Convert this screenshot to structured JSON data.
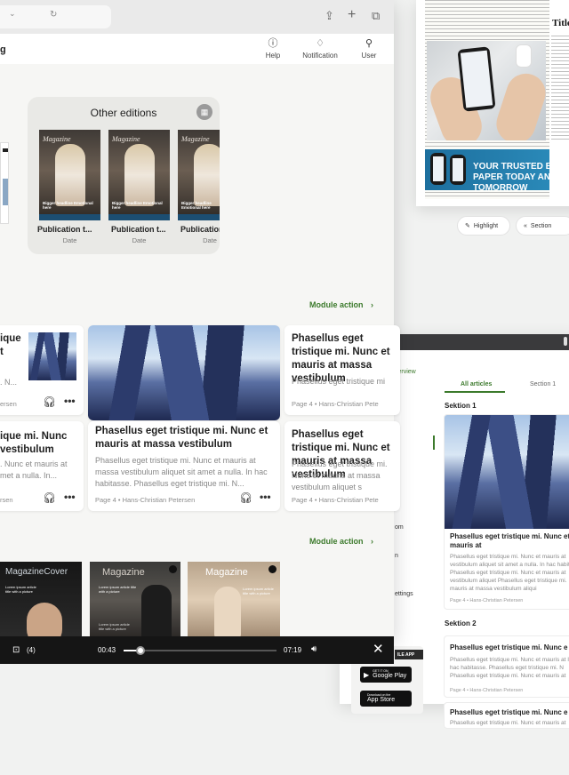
{
  "news_window": {
    "banner_text": "YOUR TRUSTED E-PAPER TODAY AND TOMORROW",
    "side_title": "Title",
    "buttons": [
      {
        "label": "Highlight",
        "icon": "highlight-icon"
      },
      {
        "label": "Section",
        "icon": "chevrons-left-icon"
      }
    ]
  },
  "list_window": {
    "tabs": [
      "All articles",
      "Section 1"
    ],
    "side_labels": [
      "verview",
      "nt",
      "om",
      "n",
      "ettings"
    ],
    "app_badge": "ILE APP",
    "stores": [
      {
        "small": "GET IT ON",
        "big": "Google Play",
        "icon": "google-play-icon"
      },
      {
        "small": "Download on the",
        "big": "App Store",
        "icon": "apple-icon"
      }
    ],
    "sections": [
      {
        "title": "Sektion 1"
      },
      {
        "title": "Sektion 2"
      }
    ],
    "articles": [
      {
        "title": "Phasellus eget tristique mi. Nunc et mauris at",
        "body": "Phasellus eget tristique mi. Nunc et mauris at vestibulum aliquet sit amet a nulla. In hac habita Phasellus eget tristique mi. Nunc et mauris at vestibulum aliquet Phasellus eget tristique mi. mauris at massa vestibulum aliqui",
        "meta": "Page 4 • Hans-Christian Petersen"
      },
      {
        "title": "Phasellus eget tristique mi. Nunc e",
        "body": "Phasellus eget tristique mi. Nunc et mauris at In hac habitasse. Phasellus eget tristique mi. N Phasellus eget tristique mi. Nunc et mauris at",
        "meta": "Page 4 • Hans-Christian Petersen"
      },
      {
        "title": "Phasellus eget tristique mi. Nunc e",
        "body": "Phasellus eget tristique mi. Nunc et mauris at",
        "meta": ""
      }
    ]
  },
  "main_window": {
    "app_title_fragment": "g",
    "header": [
      {
        "label": "Help",
        "icon": "help-icon"
      },
      {
        "label": "Notification",
        "icon": "bell-icon"
      },
      {
        "label": "User",
        "icon": "user-icon"
      }
    ],
    "editions": {
      "title": "Other editions",
      "items": [
        {
          "title": "Publication t...",
          "date": "Date",
          "cover_title": "Magazine",
          "headline": "Bigger headline Emotional here"
        },
        {
          "title": "Publication t...",
          "date": "Date",
          "cover_title": "Magazine",
          "headline": "Bigger headline Emotional here"
        },
        {
          "title": "Publication t",
          "date": "Date",
          "cover_title": "Magazine",
          "headline": "Bigger headline Emotional here"
        }
      ]
    },
    "module_action_1": "Module action",
    "module_action_2": "Module action",
    "cards": [
      {
        "title": "ique\nt",
        "body": ". N...",
        "meta": "ersen"
      },
      {
        "title": "Phasellus eget tristique mi. Nunc et mauris at massa vestibulum",
        "body": "Phasellus eget tristique mi. Nunc et mauris at massa vestibulum aliquet sit amet a nulla. In hac habitasse. Phasellus eget tristique mi. N...",
        "meta": "Page 4 • Hans-Christian Petersen"
      },
      {
        "title": "Phasellus eget tristique mi. Nunc et mauris at massa vestibulum",
        "body": "Phasellus eget tristique mi",
        "meta": "Page 4 • Hans-Christian Pete"
      },
      {
        "title": "ique mi. Nunc\nvestibulum",
        "body": ". Nunc et mauris at\nmet a nulla. In...",
        "meta": "rsen"
      },
      {
        "title": "Phasellus eget tristique mi. Nunc et mauris at massa vestibulum",
        "body": "Phasellus eget tristique mi. Nunc et mauris at massa vestibulum aliquet s",
        "meta": "Page 4 • Hans-Christian Petersen"
      }
    ],
    "magazines": [
      {
        "title": "MagazineCover",
        "text": "Lorem ipsum article title with a picture",
        "sub": "Lorem ipsum article title with a picture"
      },
      {
        "title": "Magazine",
        "text": "Lorem ipsum article title with a picture",
        "sub": "Lorem ipsum article title with a picture"
      },
      {
        "title": "Magazine",
        "text": "Lorem ipsum article title with a picture",
        "sub": "Lorem ipsum article title with a picture"
      }
    ],
    "player": {
      "queue": "(4)",
      "elapsed": "00:43",
      "total": "07:19",
      "progress": 0.11
    }
  }
}
